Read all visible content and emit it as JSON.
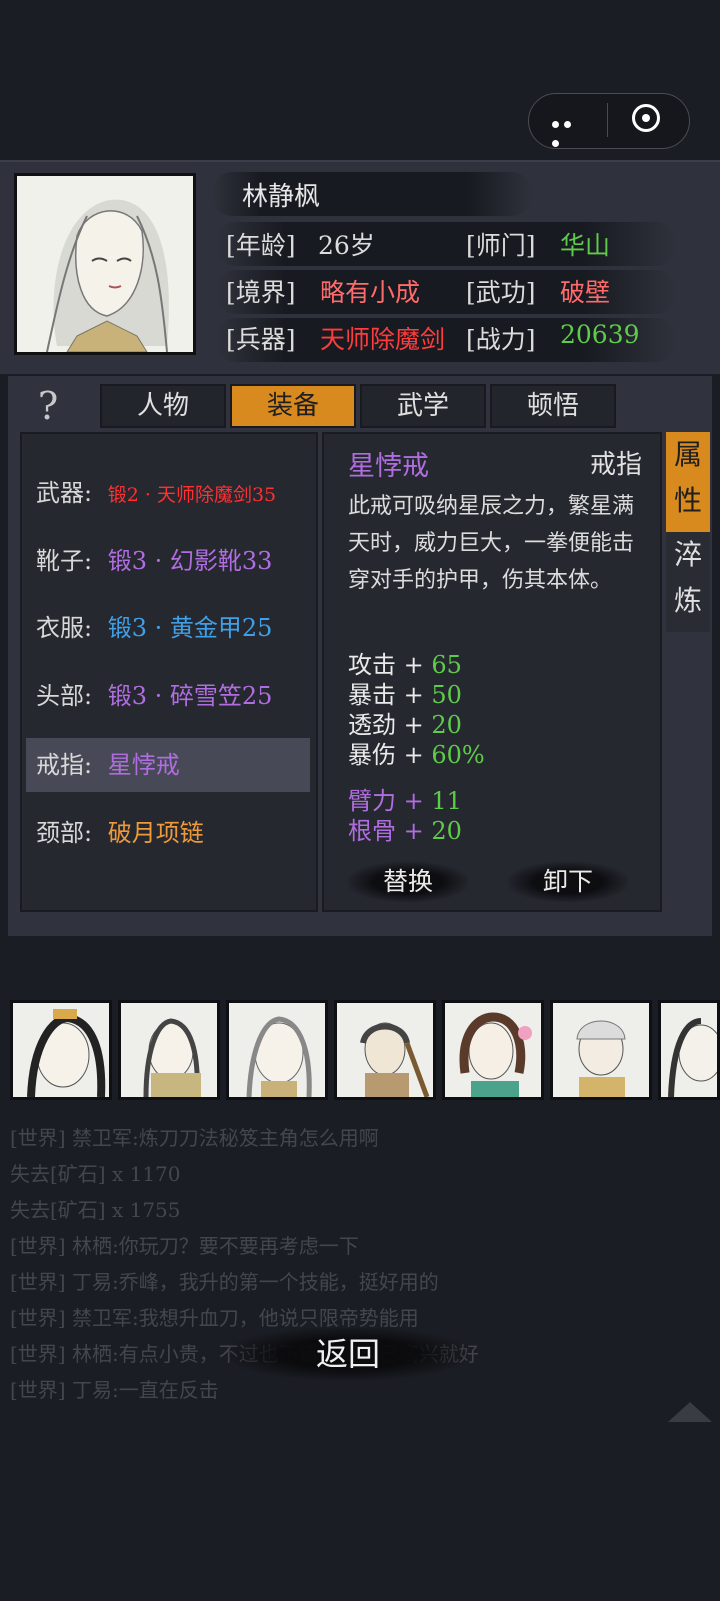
{
  "header": {
    "name": "林静枫",
    "rows": [
      {
        "l1": "[年龄]",
        "v1": "26岁",
        "c1": "#dcdcdc",
        "l2": "[师门]",
        "v2": "华山",
        "c2": "#5ecb4a"
      },
      {
        "l1": "[境界]",
        "v1": "略有小成",
        "c1": "#ff6b6b",
        "l2": "[武功]",
        "v2": "破壁",
        "c2": "#ff6b6b"
      },
      {
        "l1": "[兵器]",
        "v1": "天师除魔剑",
        "c1": "#ff3b3b",
        "l2": "[战力]",
        "v2": "20639",
        "c2": "#5ecb4a"
      }
    ]
  },
  "help": "?",
  "tabs": [
    "人物",
    "装备",
    "武学",
    "顿悟"
  ],
  "equipment": [
    {
      "slot": "武器:",
      "item": "锻2 · 天师除魔剑35",
      "color": "#ff3030"
    },
    {
      "slot": "靴子:",
      "item": "锻3 · 幻影靴33",
      "color": "#b06de0"
    },
    {
      "slot": "衣服:",
      "item": "锻3 · 黄金甲25",
      "color": "#3fa0e8"
    },
    {
      "slot": "头部:",
      "item": "锻3 · 碎雪笠25",
      "color": "#b06de0"
    },
    {
      "slot": "戒指:",
      "item": "星悖戒",
      "color": "#b06de0"
    },
    {
      "slot": "颈部:",
      "item": "破月项链",
      "color": "#ee9a3a"
    }
  ],
  "detail": {
    "name": "星悖戒",
    "type": "戒指",
    "desc": "此戒可吸纳星辰之力，繁星满天时，威力巨大，一拳便能击穿对手的护甲，伤其本体。",
    "stats": [
      {
        "k": "攻击 + ",
        "n": "65"
      },
      {
        "k": "暴击 + ",
        "n": "50"
      },
      {
        "k": "透劲 + ",
        "n": "20"
      },
      {
        "k": "暴伤 + ",
        "n": "60%"
      }
    ],
    "bonus": [
      {
        "k": "臂力 + ",
        "n": "11"
      },
      {
        "k": "根骨 + ",
        "n": "20"
      }
    ],
    "replace": "替换",
    "unequip": "卸下"
  },
  "side_tabs": [
    "属性",
    "淬炼"
  ],
  "chat": [
    "[世界] 禁卫军:炼刀刀法秘笈主角怎么用啊",
    "失去[矿石] x 1170",
    "失去[矿石] x 1755",
    "[世界] 林栖:你玩刀？要不要再考虑一下",
    "[世界] 丁易:乔峰，我升的第一个技能，挺好用的",
    "[世界] 禁卫军:我想升血刀，他说只限帝势能用",
    "[世界] 林栖:有点小贵，不过也不错，随自己高兴就好",
    "[世界] 丁易:一直在反击"
  ],
  "back": "返回"
}
